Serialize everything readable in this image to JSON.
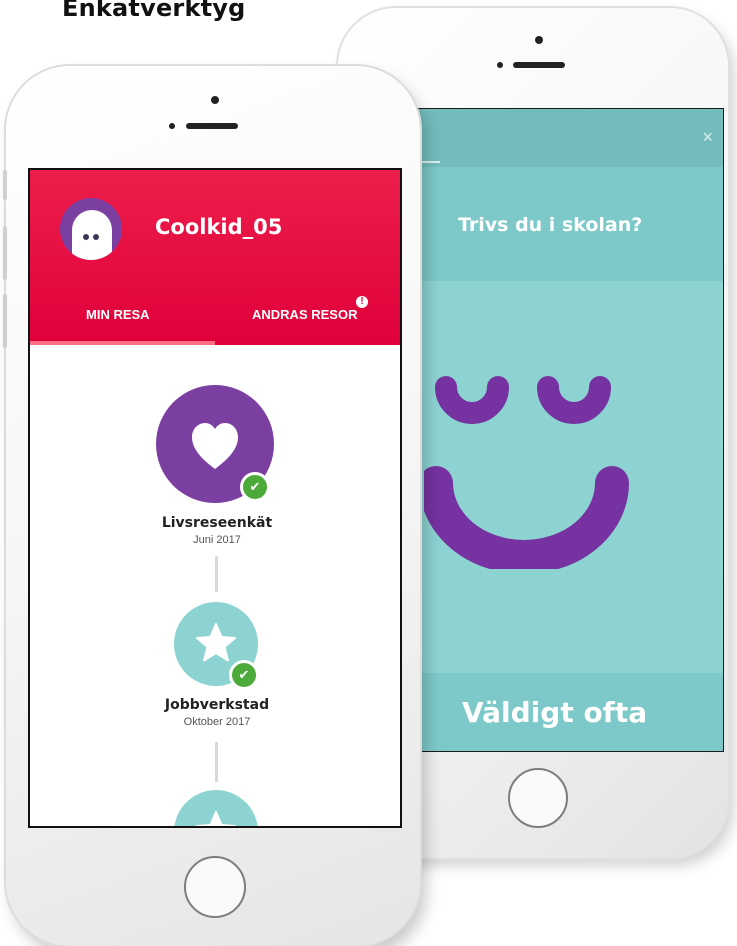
{
  "page_heading": "Enkätverktyg",
  "survey_screen": {
    "close_symbol": "×",
    "question": "Trivs du i skolan?",
    "answer": "Väldigt ofta",
    "face_icon": "smiley-face-icon",
    "colors": {
      "background": "#8dd3d2",
      "face": "#7532a0"
    }
  },
  "profile_screen": {
    "username": "Coolkid_05",
    "tabs": [
      {
        "label": "MIN RESA",
        "active": true
      },
      {
        "label": "ANDRAS RESOR",
        "badge": "!"
      }
    ],
    "journey": [
      {
        "title": "Livsreseenkät",
        "date": "Juni 2017",
        "icon": "heart-icon",
        "completed": true
      },
      {
        "title": "Jobbverkstad",
        "date": "Oktober 2017",
        "icon": "star-icon",
        "completed": true
      },
      {
        "icon": "star-icon"
      }
    ],
    "colors": {
      "header": "#e0003a",
      "purple": "#7b3fa2",
      "teal": "#8dd3d2",
      "check": "#4caa3a"
    }
  }
}
